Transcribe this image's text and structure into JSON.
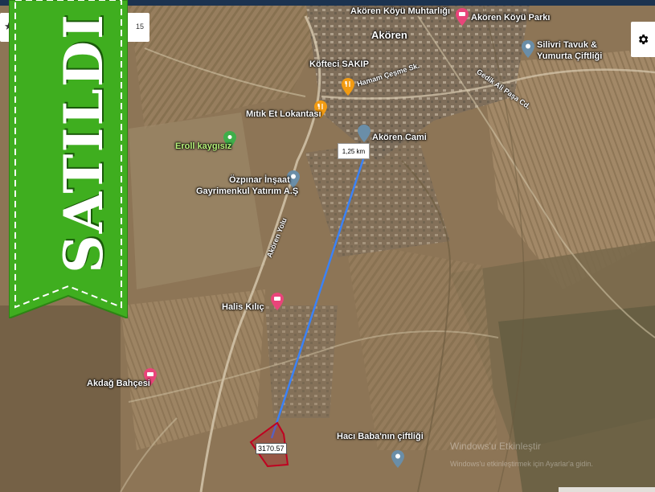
{
  "banner": {
    "text": "SATILDI",
    "color": "#3fae1f"
  },
  "top_control": {
    "value": "15"
  },
  "settings": {
    "icon": "gear-icon"
  },
  "distance": {
    "label": "1,25 km"
  },
  "parcel": {
    "label": "3170.57",
    "color": "#c00020"
  },
  "route": {
    "color": "#3b82f6"
  },
  "places": {
    "akoren_koyu_muhtarligi": "Akören Köyü Muhtarlığı",
    "akoren_koyu_parki": "Akören Köyü Parkı",
    "akoren": "Akören",
    "silivri_tavuk_1": "Silivri Tavuk &",
    "silivri_tavuk_2": "Yumurta Çiftliği",
    "kofteci_sakip": "Köfteci SAKIP",
    "mitik_et": "Mıtık Et Lokantası",
    "akoren_camii": "Akören Cami",
    "eroll_kaygisiz": "Eroll kaygısız",
    "ozpinar_1": "Özpınar İnşaat",
    "ozpinar_2": "Gayrimenkul Yatırım A.Ş",
    "halis_kilic": "Halis Kılıç",
    "akdag_bahcesi": "Akdağ Bahçesi",
    "haci_baba": "Hacı Baba'nın çiftliği"
  },
  "roads": {
    "hamam_cesme": "Hamam Çeşme Sk.",
    "gedik_ali_pasa": "Gedik Ali Paşa Cd.",
    "akoren_yolu": "Akören Yolu"
  },
  "watermark": {
    "line1": "Windows'u Etkinleştir",
    "line2": "Windows'u etkinleştirmek için Ayarlar'a gidin."
  }
}
